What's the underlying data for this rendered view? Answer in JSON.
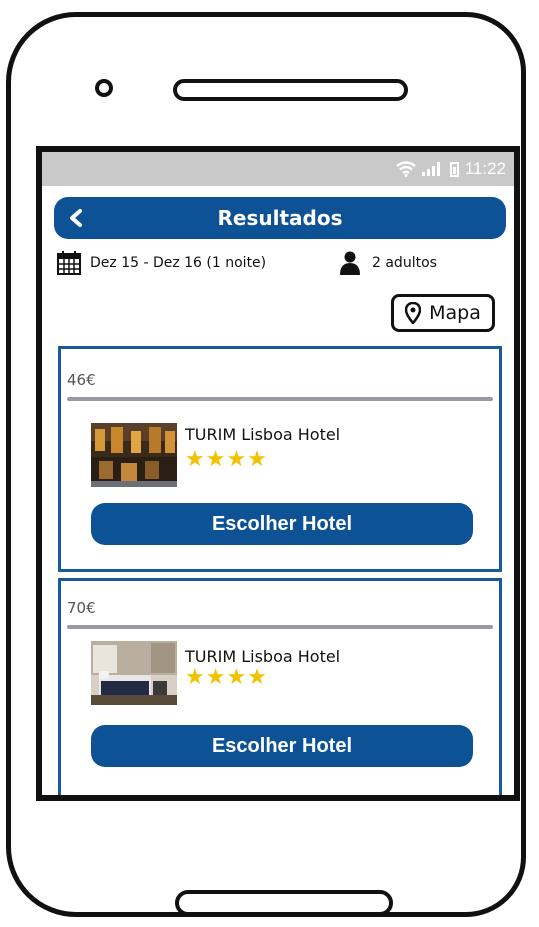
{
  "status_bar": {
    "time": "11:22"
  },
  "header": {
    "title": "Resultados"
  },
  "search_info": {
    "dates": "Dez 15 - Dez 16 (1 noite)",
    "guests": "2 adultos"
  },
  "map_button": {
    "label": "Mapa"
  },
  "results": [
    {
      "price": "46€",
      "hotel_name": "TURIM Lisboa Hotel",
      "stars": "★★★★",
      "button_label": "Escolher Hotel"
    },
    {
      "price": "70€",
      "hotel_name": "TURIM Lisboa Hotel",
      "stars": "★★★★",
      "button_label": "Escolher Hotel"
    }
  ],
  "colors": {
    "primary": "#0e5296",
    "star": "#f2c200",
    "statusbar": "#c9c9c9"
  }
}
